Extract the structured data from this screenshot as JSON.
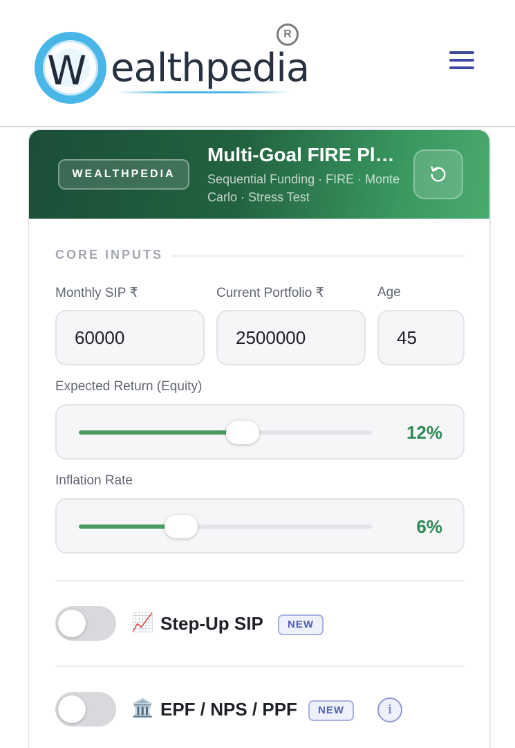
{
  "header": {
    "logo_letter": "W",
    "logo_text": "ealthpedia",
    "logo_reg": "R"
  },
  "card": {
    "badge": "WEALTHPEDIA",
    "title": "Multi-Goal FIRE Pl…",
    "subtitle": "Sequential Funding · FIRE · Monte Carlo · Stress Test",
    "reset_icon": "reset-icon"
  },
  "core_inputs": {
    "section_label": "CORE INPUTS",
    "monthly_sip": {
      "label": "Monthly SIP ₹",
      "value": "60000"
    },
    "current_portfolio": {
      "label": "Current Portfolio ₹",
      "value": "2500000"
    },
    "age": {
      "label": "Age",
      "value": "45"
    },
    "expected_return": {
      "label": "Expected Return (Equity)",
      "value_text": "12%",
      "fill_fraction": 0.56
    },
    "inflation_rate": {
      "label": "Inflation Rate",
      "value_text": "6%",
      "fill_fraction": 0.35
    }
  },
  "toggles": [
    {
      "icon": "📈",
      "icon_name": "chart-increasing-icon",
      "label": "Step-Up SIP",
      "badge": "NEW",
      "on": false
    },
    {
      "icon": "🏛️",
      "icon_name": "classical-building-icon",
      "label": "EPF / NPS / PPF",
      "badge": "NEW",
      "on": false,
      "info": "i"
    }
  ],
  "colors": {
    "accent_green": "#2e8a55",
    "header_green": "#1b4e38",
    "badge_blue": "#5160b8"
  }
}
